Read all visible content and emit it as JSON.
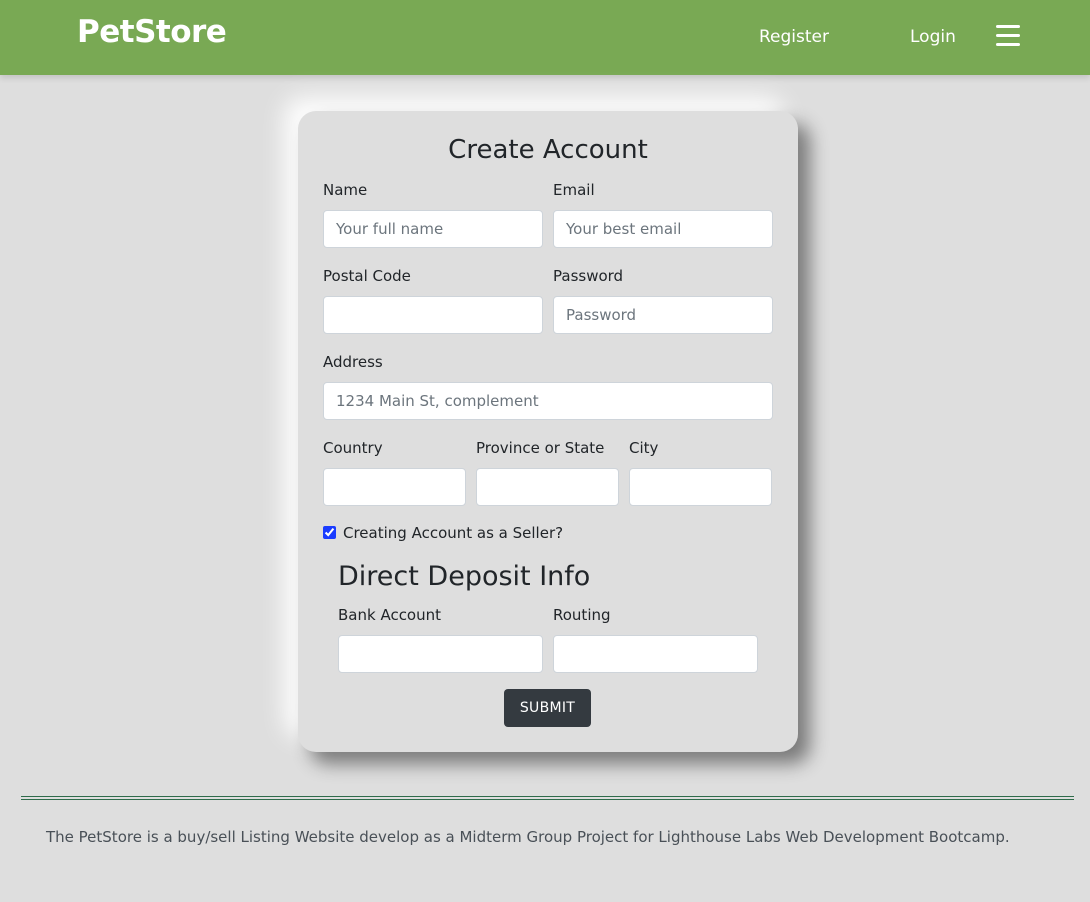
{
  "navbar": {
    "brand": "PetStore",
    "register": "Register",
    "login": "Login",
    "menu_icon": "hamburger-menu-icon"
  },
  "form": {
    "title": "Create Account",
    "name_label": "Name",
    "name_placeholder": "Your full name",
    "email_label": "Email",
    "email_placeholder": "Your best email",
    "postal_label": "Postal Code",
    "postal_value": "",
    "password_label": "Password",
    "password_placeholder": "Password",
    "address_label": "Address",
    "address_placeholder": "1234 Main St, complement",
    "country_label": "Country",
    "province_label": "Province or State",
    "city_label": "City",
    "seller_label": "Creating Account as a Seller?",
    "seller_checked": true,
    "deposit_title": "Direct Deposit Info",
    "bank_label": "Bank Account",
    "routing_label": "Routing",
    "submit_label": "SUBMIT"
  },
  "footer": {
    "text": "The PetStore is a buy/sell Listing Website develop as a Midterm Group Project for Lighthouse Labs Web Development Bootcamp."
  },
  "colors": {
    "navbar": "#79a954",
    "background": "#dedede",
    "button": "#343a40"
  }
}
